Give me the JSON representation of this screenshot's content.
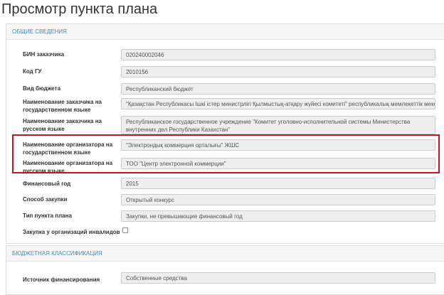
{
  "page_title": "Просмотр пункта плана",
  "general": {
    "heading": "ОБЩИЕ СВЕДЕНИЯ",
    "fields": [
      {
        "label": "БИН заказчика",
        "value": "020240002046"
      },
      {
        "label": "Код ГУ",
        "value": "2010156"
      },
      {
        "label": "Вид бюджета",
        "value": "Республиканский бюджет"
      },
      {
        "label": "Наименование заказчика на государственном языке",
        "value": "\"Қазақстан Республикасы Ішкі істер министрлігі Қылмыстық-атқару жүйесі комитеті\" республикалық мемлекеттік мекемесі"
      },
      {
        "label": "Наименование заказчика на русском языке",
        "value": "Республиканское государственное учреждение \"Комитет уголовно-исполнительной системы Министерства внутренних дел Республики Казахстан\""
      },
      {
        "label": "Наименование организатора на государственном языке",
        "value": "\"Электрондық коммерция орталығы\" ЖШС"
      },
      {
        "label": "Наименование организатора на русском языке",
        "value": "ТОО \"Центр электронной коммерции\""
      },
      {
        "label": "Финансовый год",
        "value": "2015"
      },
      {
        "label": "Способ закупки",
        "value": "Открытый конкурс"
      },
      {
        "label": "Тип пункта плана",
        "value": "Закупки, не превышающие финансовый год"
      },
      {
        "label": "Закупка у организаций инвалидов",
        "checked": false
      }
    ]
  },
  "budget": {
    "heading": "БЮДЖЕТНАЯ КЛАССИФИКАЦИЯ",
    "fields": [
      {
        "label": "Источник финансирования",
        "value": "Собственные средства"
      }
    ]
  },
  "colors": {
    "heading_text": "#3f8ec5",
    "highlight": "#c0161c",
    "field_bg": "#eeeeee"
  }
}
